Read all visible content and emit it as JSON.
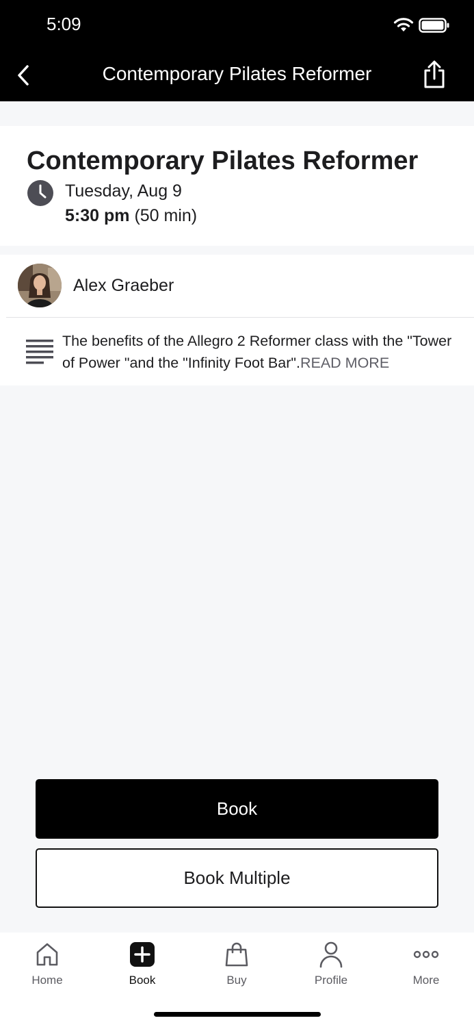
{
  "status_bar": {
    "time": "5:09",
    "icons": [
      "wifi-icon",
      "battery-icon"
    ]
  },
  "nav_bar": {
    "title": "Contemporary Pilates Reformer",
    "back_icon": "chevron-left-icon",
    "share_icon": "share-icon"
  },
  "class_info": {
    "title": "Contemporary Pilates Reformer",
    "date": "Tuesday, Aug 9",
    "start_time": "5:30 pm",
    "duration": "(50 min)"
  },
  "instructor": {
    "name": "Alex Graeber"
  },
  "description": {
    "text": "The benefits of the Allegro 2 Reformer class with the \"Tower of Power \"and the \"Infinity Foot Bar\".",
    "read_more": "READ MORE"
  },
  "actions": {
    "book_label": "Book",
    "book_multiple_label": "Book Multiple"
  },
  "tab_bar": {
    "items": [
      {
        "label": "Home",
        "icon": "home-icon"
      },
      {
        "label": "Book",
        "icon": "plus-square-icon",
        "active": true
      },
      {
        "label": "Buy",
        "icon": "shopping-bag-icon"
      },
      {
        "label": "Profile",
        "icon": "person-icon"
      },
      {
        "label": "More",
        "icon": "more-dots-icon"
      }
    ]
  },
  "colors": {
    "header_bg": "#000000",
    "page_bg": "#f6f7f9",
    "primary_button": "#000000"
  }
}
